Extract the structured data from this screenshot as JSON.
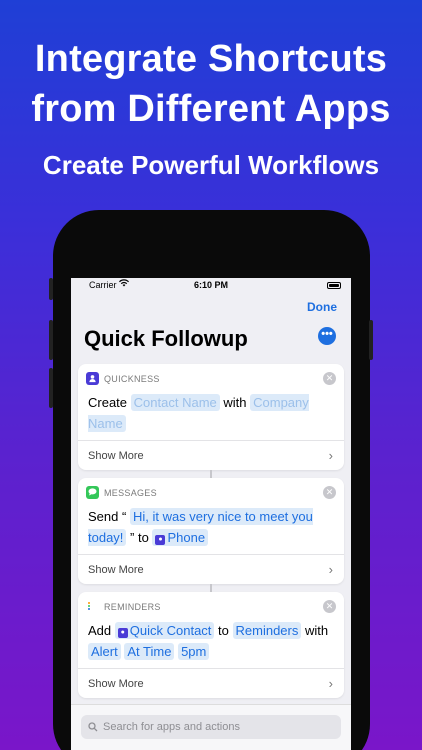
{
  "promo": {
    "headline_line1": "Integrate Shortcuts",
    "headline_line2": "from Different Apps",
    "subheadline": "Create Powerful Workflows"
  },
  "statusbar": {
    "carrier": "Carrier",
    "time": "6:10 PM"
  },
  "nav": {
    "done_label": "Done",
    "title": "Quick Followup"
  },
  "cards": [
    {
      "app_name": "QUICKNESS",
      "app_icon_color": "#4a3bd6",
      "verb": "Create",
      "token1": "Contact Name",
      "connector1": "with",
      "token2": "Company Name",
      "show_more": "Show More"
    },
    {
      "app_name": "MESSAGES",
      "app_icon_color": "#34c759",
      "verb": "Send",
      "open_quote": "“",
      "token1": "Hi, it was very nice to meet you today!",
      "close_quote": "” to",
      "token2": "Phone",
      "show_more": "Show More"
    },
    {
      "app_name": "REMINDERS",
      "verb": "Add",
      "token1": "Quick Contact",
      "connector1": "to",
      "token2": "Reminders",
      "connector2": "with",
      "token3": "Alert",
      "token4": "At Time",
      "token5": "5pm",
      "show_more": "Show More"
    }
  ],
  "search": {
    "placeholder": "Search for apps and actions"
  },
  "colors": {
    "accent": "#1e6fe0",
    "token_bg": "#dceaf9"
  }
}
